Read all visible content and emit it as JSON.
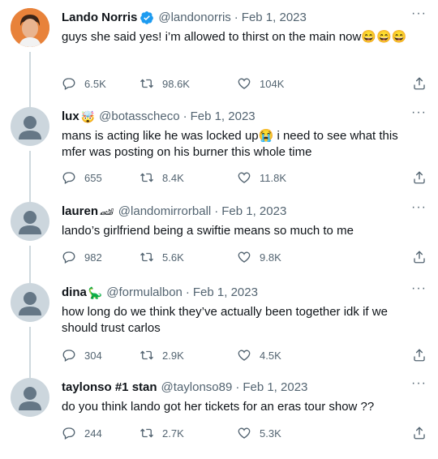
{
  "tweets": [
    {
      "display_name": "Lando Norris",
      "verified": true,
      "handle": "@landonorris",
      "date": "Feb 1, 2023",
      "badge_emoji": "",
      "text": "guys she said yes! i’m allowed to thirst on the main now😄😄😄",
      "replies": "6.5K",
      "retweets": "98.6K",
      "likes": "104K"
    },
    {
      "display_name": "lux",
      "verified": false,
      "handle": "@botasscheco",
      "date": "Feb 1, 2023",
      "badge_emoji": "🤯",
      "text": "mans is acting like he was locked up😭 i need to see what this mfer was posting on his burner this whole time",
      "replies": "655",
      "retweets": "8.4K",
      "likes": "11.8K"
    },
    {
      "display_name": "lauren",
      "verified": false,
      "handle": "@landomirrorball",
      "date": "Feb 1, 2023",
      "badge_emoji": "🏎",
      "text": "lando’s girlfriend being a swiftie means so much to me",
      "replies": "982",
      "retweets": "5.6K",
      "likes": "9.8K"
    },
    {
      "display_name": "dina",
      "verified": false,
      "handle": "@formulalbon",
      "date": "Feb 1, 2023",
      "badge_emoji": "🦕",
      "text": "how long do we think they’ve actually been together idk if we should trust carlos",
      "replies": "304",
      "retweets": "2.9K",
      "likes": "4.5K"
    },
    {
      "display_name": "taylonso #1 stan",
      "verified": false,
      "handle": "@taylonso89",
      "date": "Feb 1, 2023",
      "badge_emoji": "",
      "text": "do you think lando got her tickets for an eras tour show ??",
      "replies": "244",
      "retweets": "2.7K",
      "likes": "5.3K"
    }
  ],
  "ui": {
    "separator": "·",
    "more_icon": "···",
    "icons": [
      "reply-icon",
      "retweet-icon",
      "like-icon",
      "share-icon",
      "verified-badge-icon",
      "more-options-icon"
    ]
  },
  "colors": {
    "text_primary": "#0f1419",
    "text_secondary": "#536471",
    "verified_blue": "#1d9bf0",
    "thread_line": "#cfd9de",
    "default_avatar": "#ccd6dd"
  }
}
